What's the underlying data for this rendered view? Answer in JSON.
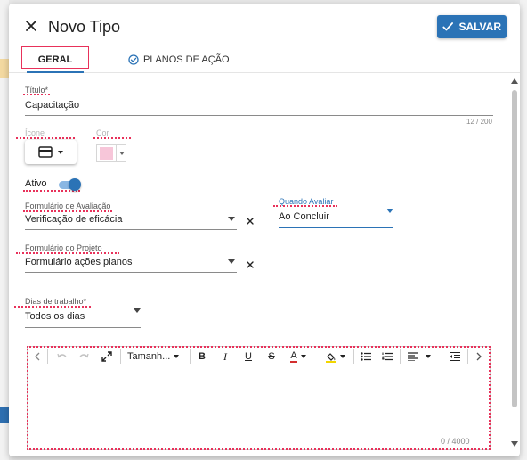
{
  "dialog": {
    "title": "Novo Tipo",
    "save_label": "SALVAR"
  },
  "tabs": [
    {
      "label": "GERAL",
      "active": true
    },
    {
      "label": "PLANOS DE AÇÃO",
      "active": false
    }
  ],
  "form": {
    "titulo": {
      "label": "Título*",
      "value": "Capacitação",
      "counter": "12 / 200"
    },
    "icone": {
      "label": "Ícone",
      "icon": "credit-card-icon"
    },
    "cor": {
      "label": "Cor",
      "value": "#f7c6d9"
    },
    "ativo": {
      "label": "Ativo",
      "checked": true
    },
    "formulario_avaliacao": {
      "label": "Formulário de Avaliação",
      "value": "Verificação de eficácia"
    },
    "quando_avaliar": {
      "label": "Quando Avaliar",
      "value": "Ao Concluir"
    },
    "formulario_projeto": {
      "label": "Formulário do Projeto",
      "value": "Formulário ações planos"
    },
    "dias_trabalho": {
      "label": "Dias de trabalho*",
      "value": "Todos os dias"
    }
  },
  "editor": {
    "font_size_label": "Tamanh...",
    "bold": "B",
    "italic": "I",
    "underline": "U",
    "strike": "S",
    "text_color": "A",
    "counter": "0 / 4000"
  },
  "colors": {
    "accent": "#2b73b6",
    "highlight_annotation": "#e8315a"
  }
}
